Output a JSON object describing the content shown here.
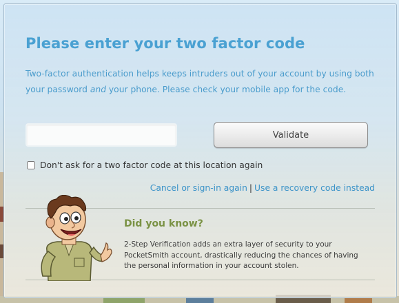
{
  "heading": "Please enter your two factor code",
  "description": {
    "part1": "Two-factor authentication helps keeps intruders out of your account by using both your password ",
    "emphasis": "and",
    "part2": " your phone. Please check your mobile app for the code."
  },
  "form": {
    "code_value": "",
    "code_placeholder": "",
    "validate_label": "Validate",
    "remember_label": "Don't ask for a two factor code at this location again",
    "remember_checked": false
  },
  "links": {
    "cancel_label": "Cancel or sign-in again",
    "separator": "|",
    "recovery_label": "Use a recovery code instead"
  },
  "tip": {
    "heading": "Did you know?",
    "text": "2-Step Verification adds an extra layer of security to your PocketSmith account, drastically reducing the chances of having the personal information in your account stolen."
  },
  "colors": {
    "heading": "#4aa1d2",
    "link": "#3b93c8",
    "tip_heading": "#7a9244"
  },
  "icons": [
    "mascot-illustration",
    "checkbox"
  ]
}
